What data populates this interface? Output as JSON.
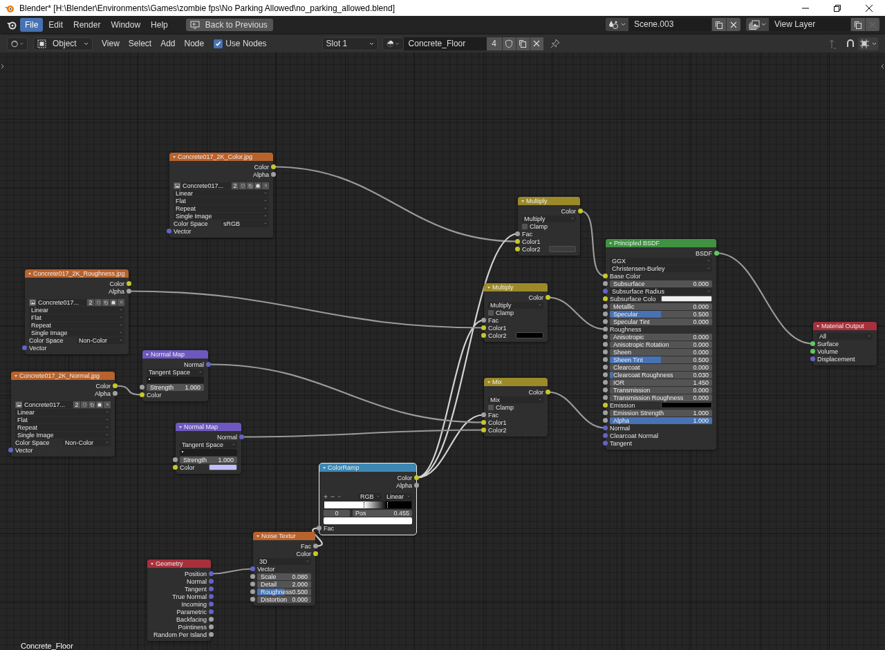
{
  "window": {
    "title": "Blender* [H:\\Blender\\Environments\\Games\\zombie fps\\No Parking Allowed\\no_parking_allowed.blend]"
  },
  "menu_bar": {
    "items": [
      {
        "label": "File",
        "selected": true
      },
      {
        "label": "Edit",
        "selected": false
      },
      {
        "label": "Render",
        "selected": false
      },
      {
        "label": "Window",
        "selected": false
      },
      {
        "label": "Help",
        "selected": false
      }
    ],
    "back_button": "Back to Previous",
    "scene": "Scene.003",
    "view_layer": "View Layer"
  },
  "header": {
    "mode": "Object",
    "menus": [
      "View",
      "Select",
      "Add",
      "Node"
    ],
    "use_nodes": {
      "label": "Use Nodes",
      "checked": true
    },
    "slot": "Slot 1",
    "material": "Concrete_Floor",
    "material_users": "4"
  },
  "nodes": [
    {
      "title": "Concrete017_2K_Color.jpg",
      "color": "#b8622c",
      "selected": false,
      "rows": [
        {
          "kind": "output",
          "label": "Color",
          "socket": {
            "color": "#c7c729"
          }
        },
        {
          "kind": "output",
          "label": "Alpha",
          "socket": {
            "color": "#a1a1a1"
          }
        },
        {
          "kind": "image",
          "value": "Concrete017...",
          "users": "2"
        },
        {
          "kind": "dropdown",
          "value": "Linear"
        },
        {
          "kind": "dropdown",
          "value": "Flat"
        },
        {
          "kind": "dropdown",
          "value": "Repeat"
        },
        {
          "kind": "dropdown",
          "value": "Single Image"
        },
        {
          "kind": "property",
          "label": "Color Space",
          "value": "sRGB"
        },
        {
          "kind": "input",
          "label": "Vector",
          "socket": {
            "color": "#6363c7"
          }
        }
      ]
    },
    {
      "title": "Concrete017_2K_Roughness.jpg",
      "color": "#b8622c",
      "selected": false,
      "rows": [
        {
          "kind": "output",
          "label": "Color",
          "socket": {
            "color": "#c7c729"
          }
        },
        {
          "kind": "output",
          "label": "Alpha",
          "socket": {
            "color": "#a1a1a1"
          }
        },
        {
          "kind": "image",
          "value": "Concrete017...",
          "users": "2"
        },
        {
          "kind": "dropdown",
          "value": "Linear"
        },
        {
          "kind": "dropdown",
          "value": "Flat"
        },
        {
          "kind": "dropdown",
          "value": "Repeat"
        },
        {
          "kind": "dropdown",
          "value": "Single Image"
        },
        {
          "kind": "property",
          "label": "Color Space",
          "value": "Non-Color"
        },
        {
          "kind": "input",
          "label": "Vector",
          "socket": {
            "color": "#6363c7"
          }
        }
      ]
    },
    {
      "title": "Concrete017_2K_Normal.jpg",
      "color": "#b8622c",
      "selected": false,
      "rows": [
        {
          "kind": "output",
          "label": "Color",
          "socket": {
            "color": "#c7c729"
          }
        },
        {
          "kind": "output",
          "label": "Alpha",
          "socket": {
            "color": "#a1a1a1"
          }
        },
        {
          "kind": "image",
          "value": "Concrete017...",
          "users": "2"
        },
        {
          "kind": "dropdown",
          "value": "Linear"
        },
        {
          "kind": "dropdown",
          "value": "Flat"
        },
        {
          "kind": "dropdown",
          "value": "Repeat"
        },
        {
          "kind": "dropdown",
          "value": "Single Image"
        },
        {
          "kind": "property",
          "label": "Color Space",
          "value": "Non-Color"
        },
        {
          "kind": "input",
          "label": "Vector",
          "socket": {
            "color": "#6363c7"
          }
        }
      ]
    },
    {
      "title": "Normal Map",
      "color": "#6e58c0",
      "selected": false,
      "rows": [
        {
          "kind": "output",
          "label": "Normal",
          "socket": {
            "color": "#6363c7"
          }
        },
        {
          "kind": "dropdown",
          "value": "Tangent Space"
        },
        {
          "kind": "uv_field"
        },
        {
          "kind": "slider",
          "label": "Strength",
          "value": "1.000",
          "socket": {
            "color": "#a1a1a1"
          }
        },
        {
          "kind": "input",
          "label": "Color",
          "socket": {
            "color": "#c7c729"
          }
        }
      ]
    },
    {
      "title": "Normal Map",
      "color": "#6e58c0",
      "selected": false,
      "rows": [
        {
          "kind": "output",
          "label": "Normal",
          "socket": {
            "color": "#6363c7"
          }
        },
        {
          "kind": "dropdown",
          "value": "Tangent Space"
        },
        {
          "kind": "uv_field"
        },
        {
          "kind": "slider",
          "label": "Strength",
          "value": "1.000",
          "socket": {
            "color": "#a1a1a1"
          }
        },
        {
          "kind": "color_input",
          "label": "Color",
          "color": "#bfbfff",
          "socket": {
            "color": "#c7c729"
          }
        }
      ]
    },
    {
      "title": "ColorRamp",
      "color": "#3d87b4",
      "selected": true,
      "rows": [
        {
          "kind": "output",
          "label": "Color",
          "socket": {
            "color": "#c7c729"
          }
        },
        {
          "kind": "output",
          "label": "Alpha",
          "socket": {
            "color": "#a1a1a1"
          }
        },
        {
          "kind": "ramp_controls",
          "mode": "RGB",
          "interpolation": "Linear"
        },
        {
          "kind": "ramp"
        },
        {
          "kind": "ramp_stop",
          "index": "0",
          "label": "Pos",
          "value": "0.455"
        },
        {
          "kind": "swatch",
          "color": "#ffffff"
        },
        {
          "kind": "input",
          "label": "Fac",
          "socket": {
            "color": "#a1a1a1"
          }
        }
      ]
    },
    {
      "title": "Noise Textur",
      "color": "#b8622c",
      "selected": false,
      "rows": [
        {
          "kind": "output",
          "label": "Fac",
          "socket": {
            "color": "#a1a1a1"
          }
        },
        {
          "kind": "output",
          "label": "Color",
          "socket": {
            "color": "#c7c729"
          }
        },
        {
          "kind": "dropdown",
          "value": "3D"
        },
        {
          "kind": "input",
          "label": "Vector",
          "socket": {
            "color": "#6363c7"
          }
        },
        {
          "kind": "slider",
          "label": "Scale",
          "value": "0.080",
          "socket": {
            "color": "#a1a1a1"
          }
        },
        {
          "kind": "slider",
          "label": "Detail",
          "value": "2.000",
          "socket": {
            "color": "#a1a1a1"
          }
        },
        {
          "kind": "slider",
          "label": "Roughness",
          "value": "0.500",
          "level": 0.5,
          "socket": {
            "color": "#a1a1a1"
          }
        },
        {
          "kind": "slider",
          "label": "Distortion",
          "value": "0.000",
          "socket": {
            "color": "#a1a1a1"
          }
        }
      ]
    },
    {
      "title": "Geometry",
      "color": "#a8303c",
      "selected": false,
      "rows": [
        {
          "kind": "output",
          "label": "Position",
          "socket": {
            "color": "#6363c7"
          }
        },
        {
          "kind": "output",
          "label": "Normal",
          "socket": {
            "color": "#6363c7"
          }
        },
        {
          "kind": "output",
          "label": "Tangent",
          "socket": {
            "color": "#6363c7"
          }
        },
        {
          "kind": "output",
          "label": "True Normal",
          "socket": {
            "color": "#6363c7"
          }
        },
        {
          "kind": "output",
          "label": "Incoming",
          "socket": {
            "color": "#6363c7"
          }
        },
        {
          "kind": "output",
          "label": "Parametric",
          "socket": {
            "color": "#6363c7"
          }
        },
        {
          "kind": "output",
          "label": "Backfacing",
          "socket": {
            "color": "#a1a1a1"
          }
        },
        {
          "kind": "output",
          "label": "Pointiness",
          "socket": {
            "color": "#a1a1a1"
          }
        },
        {
          "kind": "output",
          "label": "Random Per Island",
          "socket": {
            "color": "#a1a1a1"
          }
        }
      ]
    },
    {
      "title": "Multiply",
      "color": "#9c8a28",
      "selected": false,
      "rows": [
        {
          "kind": "output",
          "label": "Color",
          "socket": {
            "color": "#c7c729"
          }
        },
        {
          "kind": "dropdown",
          "value": "Multiply"
        },
        {
          "kind": "checkbox",
          "label": "Clamp",
          "checked": false
        },
        {
          "kind": "input",
          "label": "Fac",
          "socket": {
            "color": "#a1a1a1"
          }
        },
        {
          "kind": "input",
          "label": "Color1",
          "socket": {
            "color": "#c7c729"
          }
        },
        {
          "kind": "color_input",
          "label": "Color2",
          "color": "#3c3c3c",
          "socket": {
            "color": "#c7c729"
          }
        }
      ]
    },
    {
      "title": "Multiply",
      "color": "#9c8a28",
      "selected": false,
      "rows": [
        {
          "kind": "output",
          "label": "Color",
          "socket": {
            "color": "#c7c729"
          }
        },
        {
          "kind": "dropdown",
          "value": "Multiply"
        },
        {
          "kind": "checkbox",
          "label": "Clamp",
          "checked": false
        },
        {
          "kind": "input",
          "label": "Fac",
          "socket": {
            "color": "#a1a1a1"
          }
        },
        {
          "kind": "input",
          "label": "Color1",
          "socket": {
            "color": "#c7c729"
          }
        },
        {
          "kind": "color_input",
          "label": "Color2",
          "color": "#000000",
          "socket": {
            "color": "#c7c729"
          }
        }
      ]
    },
    {
      "title": "Mix",
      "color": "#9c8a28",
      "selected": false,
      "rows": [
        {
          "kind": "output",
          "label": "Color",
          "socket": {
            "color": "#c7c729"
          }
        },
        {
          "kind": "dropdown",
          "value": "Mix"
        },
        {
          "kind": "checkbox",
          "label": "Clamp",
          "checked": false
        },
        {
          "kind": "input",
          "label": "Fac",
          "socket": {
            "color": "#a1a1a1"
          }
        },
        {
          "kind": "input",
          "label": "Color1",
          "socket": {
            "color": "#c7c729"
          }
        },
        {
          "kind": "input",
          "label": "Color2",
          "socket": {
            "color": "#c7c729"
          }
        }
      ]
    },
    {
      "title": "Principled BSDF",
      "color": "#3f9242",
      "selected": false,
      "rows": [
        {
          "kind": "output",
          "label": "BSDF",
          "socket": {
            "color": "#63c763"
          }
        },
        {
          "kind": "dropdown",
          "value": "GGX"
        },
        {
          "kind": "dropdown",
          "value": "Christensen-Burley"
        },
        {
          "kind": "input",
          "label": "Base Color",
          "socket": {
            "color": "#c7c729"
          }
        },
        {
          "kind": "slider",
          "label": "Subsurface",
          "value": "0.000",
          "socket": {
            "color": "#a1a1a1"
          }
        },
        {
          "kind": "dropdown",
          "value": "Subsurface Radius",
          "socket": {
            "color": "#6363c7"
          }
        },
        {
          "kind": "color_input",
          "label": "Subsurface Colo",
          "color": "#f0f0f0",
          "socket": {
            "color": "#c7c729"
          }
        },
        {
          "kind": "slider",
          "label": "Metallic",
          "value": "0.000",
          "socket": {
            "color": "#a1a1a1"
          }
        },
        {
          "kind": "slider",
          "label": "Specular",
          "value": "0.500",
          "level": 0.5,
          "socket": {
            "color": "#a1a1a1"
          }
        },
        {
          "kind": "slider",
          "label": "Specular Tint",
          "value": "0.000",
          "socket": {
            "color": "#a1a1a1"
          }
        },
        {
          "kind": "input",
          "label": "Roughness",
          "socket": {
            "color": "#a1a1a1"
          }
        },
        {
          "kind": "slider",
          "label": "Anisotropic",
          "value": "0.000",
          "socket": {
            "color": "#a1a1a1"
          }
        },
        {
          "kind": "slider",
          "label": "Anisotropic Rotation",
          "value": "0.000",
          "socket": {
            "color": "#a1a1a1"
          }
        },
        {
          "kind": "slider",
          "label": "Sheen",
          "value": "0.000",
          "socket": {
            "color": "#a1a1a1"
          }
        },
        {
          "kind": "slider",
          "label": "Sheen Tint",
          "value": "0.500",
          "level": 0.5,
          "socket": {
            "color": "#a1a1a1"
          }
        },
        {
          "kind": "slider",
          "label": "Clearcoat",
          "value": "0.000",
          "socket": {
            "color": "#a1a1a1"
          }
        },
        {
          "kind": "slider",
          "label": "Clearcoat Roughness",
          "value": "0.030",
          "level": 0.03,
          "socket": {
            "color": "#a1a1a1"
          }
        },
        {
          "kind": "slider",
          "label": "IOR",
          "value": "1.450",
          "socket": {
            "color": "#a1a1a1"
          }
        },
        {
          "kind": "slider",
          "label": "Transmission",
          "value": "0.000",
          "socket": {
            "color": "#a1a1a1"
          }
        },
        {
          "kind": "slider",
          "label": "Transmission Roughness",
          "value": "0.000",
          "socket": {
            "color": "#a1a1a1"
          }
        },
        {
          "kind": "color_input",
          "label": "Emission",
          "color": "#000000",
          "socket": {
            "color": "#c7c729"
          }
        },
        {
          "kind": "slider",
          "label": "Emission Strength",
          "value": "1.000",
          "socket": {
            "color": "#a1a1a1"
          }
        },
        {
          "kind": "slider",
          "label": "Alpha",
          "value": "1.000",
          "level": 1,
          "socket": {
            "color": "#a1a1a1"
          }
        },
        {
          "kind": "input",
          "label": "Normal",
          "socket": {
            "color": "#6363c7"
          }
        },
        {
          "kind": "input",
          "label": "Clearcoat Normal",
          "socket": {
            "color": "#6363c7"
          }
        },
        {
          "kind": "input",
          "label": "Tangent",
          "socket": {
            "color": "#6363c7"
          }
        }
      ]
    },
    {
      "title": "Material Output",
      "color": "#a8303c",
      "selected": false,
      "rows": [
        {
          "kind": "dropdown",
          "value": "All"
        },
        {
          "kind": "input",
          "label": "Surface",
          "socket": {
            "color": "#63c763"
          }
        },
        {
          "kind": "input",
          "label": "Volume",
          "socket": {
            "color": "#63c763"
          }
        },
        {
          "kind": "input",
          "label": "Displacement",
          "socket": {
            "color": "#6363c7"
          }
        }
      ]
    }
  ],
  "material_label": "Concrete_Floor"
}
